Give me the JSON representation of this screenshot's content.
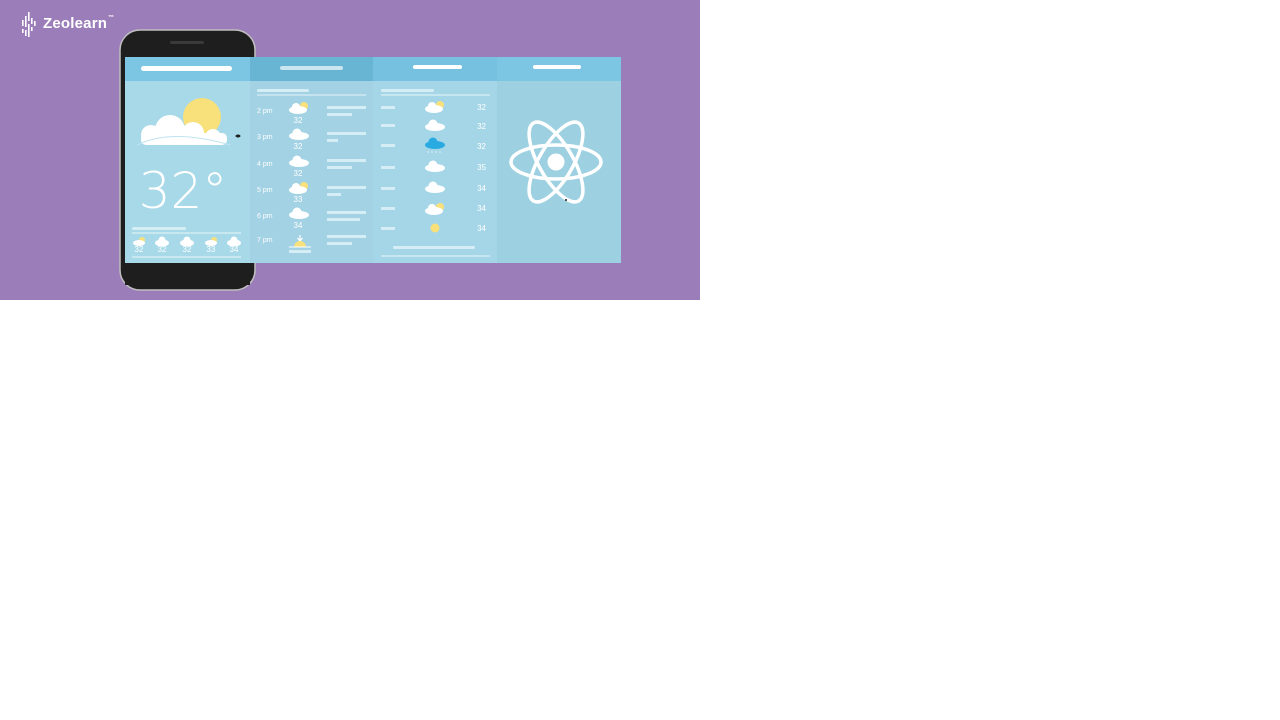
{
  "brand": {
    "name": "Zeolearn",
    "tm": "™",
    "background": "#9b7eb9"
  },
  "current": {
    "temperature": "32°"
  },
  "mini_forecast": [
    "32",
    "32",
    "32",
    "33",
    "34"
  ],
  "hourly": [
    {
      "time": "2 pm",
      "temp": "32",
      "icon": "partly-cloudy-icon"
    },
    {
      "time": "3 pm",
      "temp": "32",
      "icon": "cloud-icon"
    },
    {
      "time": "4 pm",
      "temp": "32",
      "icon": "cloud-icon"
    },
    {
      "time": "5 pm",
      "temp": "33",
      "icon": "partly-cloudy-icon"
    },
    {
      "time": "6 pm",
      "temp": "34",
      "icon": "cloud-icon"
    },
    {
      "time": "7 pm",
      "temp": "",
      "icon": "sunset-icon"
    }
  ],
  "daily": [
    {
      "temp": "32",
      "icon": "partly-cloudy-icon"
    },
    {
      "temp": "32",
      "icon": "cloud-icon"
    },
    {
      "temp": "32",
      "icon": "rain-cloud-icon"
    },
    {
      "temp": "35",
      "icon": "cloud-icon"
    },
    {
      "temp": "34",
      "icon": "cloud-icon"
    },
    {
      "temp": "34",
      "icon": "partly-cloudy-icon"
    },
    {
      "temp": "34",
      "icon": "sun-icon"
    }
  ],
  "colors": {
    "panel": "#a8d9e8",
    "header": "#7cc5e3",
    "sun": "#f8e07a",
    "rain": "#29abe2"
  }
}
